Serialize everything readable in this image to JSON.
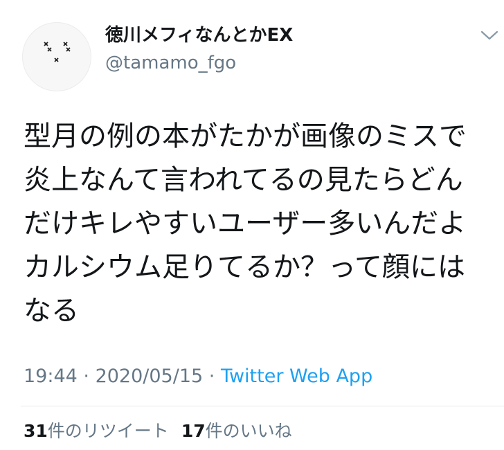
{
  "user": {
    "display_name": "徳川メフィなんとかEX",
    "handle": "@tamamo_fgo"
  },
  "tweet": {
    "lines": [
      "型月の例の本がたかが画像のミスで",
      "炎上なんて言われてるの見たらどん",
      "だけキレやすいユーザー多いんだよ",
      "カルシウム足りてるか？って顔には",
      "なる"
    ]
  },
  "meta": {
    "time": "19:44",
    "sep1": " · ",
    "date": "2020/05/15",
    "sep2": " · ",
    "source": "Twitter Web App"
  },
  "stats": {
    "retweets_count": "31",
    "retweets_label": "件のリツイート",
    "likes_count": "17",
    "likes_label": "件のいいね"
  },
  "icons": {
    "menu": "chevron-down-icon",
    "avatar": "avatar"
  },
  "colors": {
    "text": "#14171a",
    "secondary": "#657786",
    "link": "#1da1f2",
    "divider": "#e1e8ed"
  }
}
